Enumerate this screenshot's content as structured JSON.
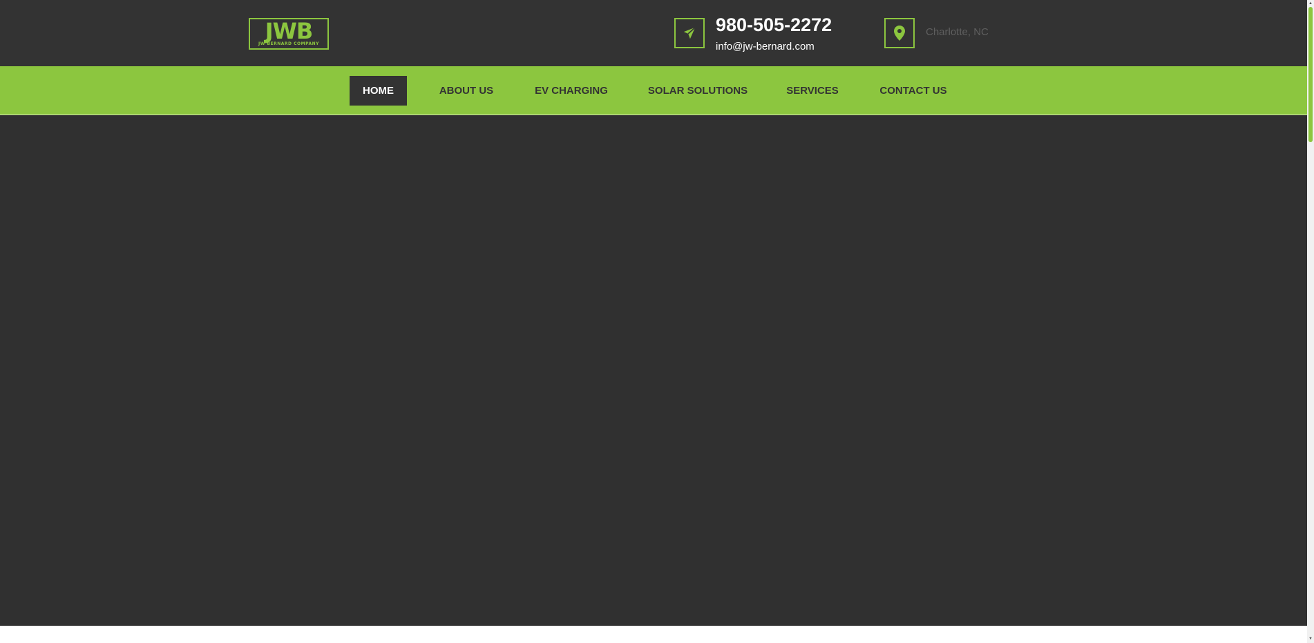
{
  "header": {
    "logo": {
      "mark": "JWB",
      "subtitle": "JW BERNARD COMPANY"
    },
    "contact": {
      "phone": "980-505-2272",
      "email": "info@jw-bernard.com",
      "location": "Charlotte, NC",
      "phone_icon": "paper-plane-icon",
      "location_icon": "map-pin-icon"
    }
  },
  "nav": {
    "items": [
      {
        "label": "HOME",
        "active": true
      },
      {
        "label": "ABOUT US",
        "active": false
      },
      {
        "label": "EV CHARGING",
        "active": false
      },
      {
        "label": "SOLAR SOLUTIONS",
        "active": false
      },
      {
        "label": "SERVICES",
        "active": false
      },
      {
        "label": "CONTACT US",
        "active": false
      }
    ]
  },
  "colors": {
    "accent": "#8cc63f",
    "dark": "#333333",
    "hero": "#303030"
  }
}
